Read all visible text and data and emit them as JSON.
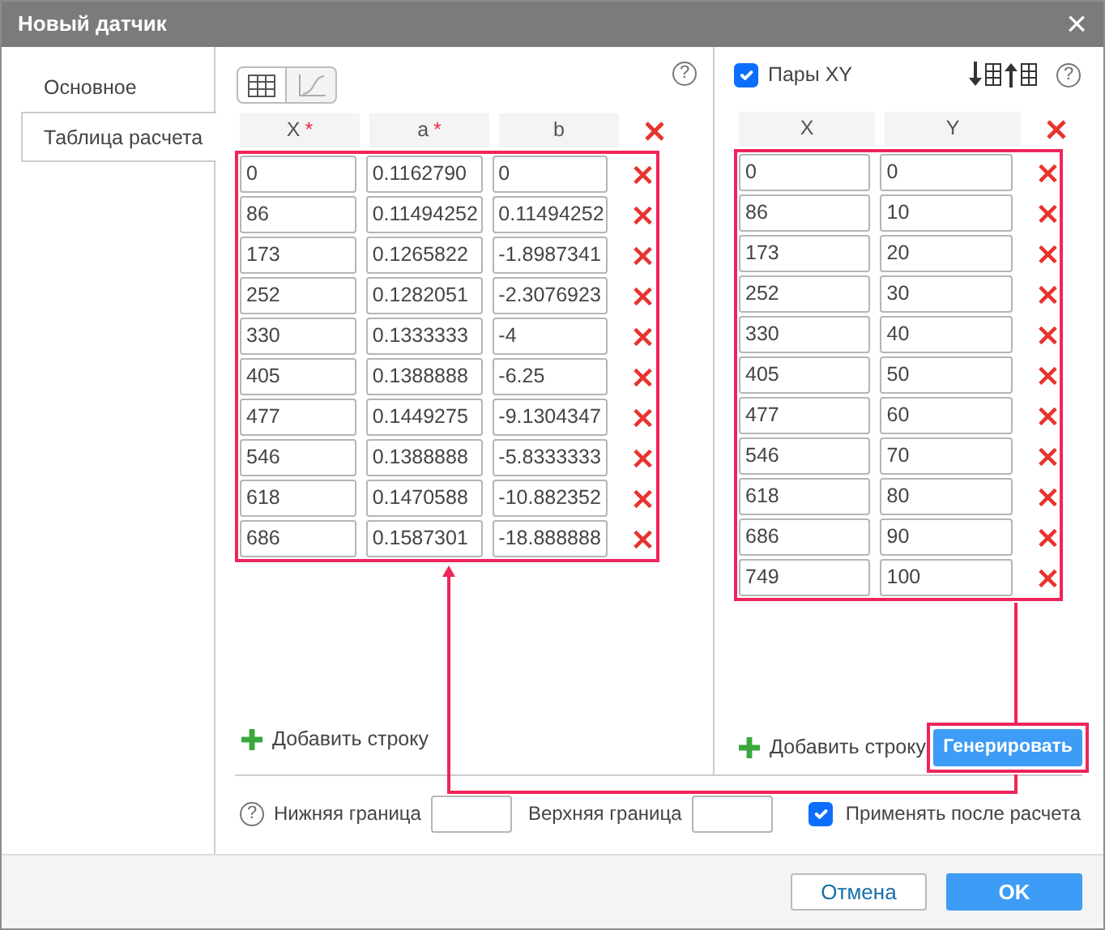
{
  "window": {
    "title": "Новый датчик",
    "close": "×"
  },
  "tabs": [
    {
      "label": "Основное",
      "selected": false
    },
    {
      "label": "Таблица расчета",
      "selected": true
    }
  ],
  "view_toggle": [
    {
      "kind": "table",
      "selected": true
    },
    {
      "kind": "chart",
      "selected": false
    }
  ],
  "calc_help": "?",
  "calc_table": {
    "columns": [
      {
        "label": "X",
        "mark": "*"
      },
      {
        "label": "a",
        "mark": "*"
      },
      {
        "label": "b"
      }
    ],
    "rows": [
      [
        "0",
        "0.1162790",
        "0"
      ],
      [
        "86",
        "0.11494252",
        "0.11494252"
      ],
      [
        "173",
        "0.1265822",
        "-1.8987341"
      ],
      [
        "252",
        "0.1282051",
        "-2.3076923"
      ],
      [
        "330",
        "0.1333333",
        "-4"
      ],
      [
        "405",
        "0.1388888",
        "-6.25"
      ],
      [
        "477",
        "0.1449275",
        "-9.1304347"
      ],
      [
        "546",
        "0.1388888",
        "-5.8333333"
      ],
      [
        "618",
        "0.1470588",
        "-10.882352"
      ],
      [
        "686",
        "0.1587301",
        "-18.888888"
      ]
    ]
  },
  "calc_add_row": "Добавить строку",
  "xy_pairs": {
    "label": "Пары XY",
    "checked": true,
    "help": "?",
    "columns": [
      {
        "label": "X"
      },
      {
        "label": "Y"
      }
    ],
    "rows": [
      [
        "0",
        "0"
      ],
      [
        "86",
        "10"
      ],
      [
        "173",
        "20"
      ],
      [
        "252",
        "30"
      ],
      [
        "330",
        "40"
      ],
      [
        "405",
        "50"
      ],
      [
        "477",
        "60"
      ],
      [
        "546",
        "70"
      ],
      [
        "618",
        "80"
      ],
      [
        "686",
        "90"
      ],
      [
        "749",
        "100"
      ]
    ]
  },
  "xy_add_row": "Добавить строку",
  "generate_button": "Генерировать",
  "bounds": {
    "help": "?",
    "lower_label": "Нижняя граница",
    "upper_label": "Верхняя граница",
    "apply_after": {
      "label": "Применять после расчета",
      "checked": true
    }
  },
  "buttons": [
    {
      "label": "Отмена",
      "kind": "secondary"
    },
    {
      "label": "OK",
      "kind": "primary"
    }
  ]
}
